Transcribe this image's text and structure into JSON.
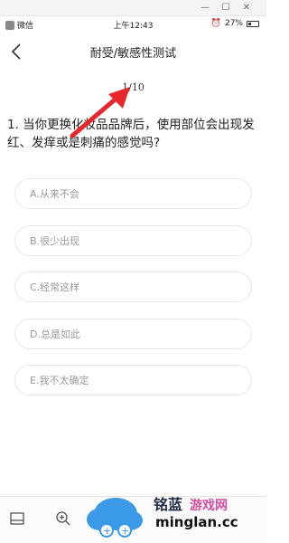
{
  "status": {
    "carrier": "微信",
    "time": "上午12:43",
    "battery": "27%"
  },
  "nav": {
    "title": "耐受/敏感性测试"
  },
  "quiz": {
    "progress": "1/10",
    "question": "1. 当你更换化妆品品牌后，使用部位会出现发红、发痒或是刺痛的感觉吗?",
    "options": [
      "A.从来不会",
      "B.很少出现",
      "C.经常这样",
      "D.总是如此",
      "E.我不太确定"
    ]
  },
  "watermark": {
    "brand_cn": "铭蓝",
    "brand_tag": "游戏网",
    "domain": "minglan.cc"
  },
  "colors": {
    "arrow": "#e8272c",
    "option_border": "#e6e6e6",
    "option_text": "#9a9a9a"
  }
}
